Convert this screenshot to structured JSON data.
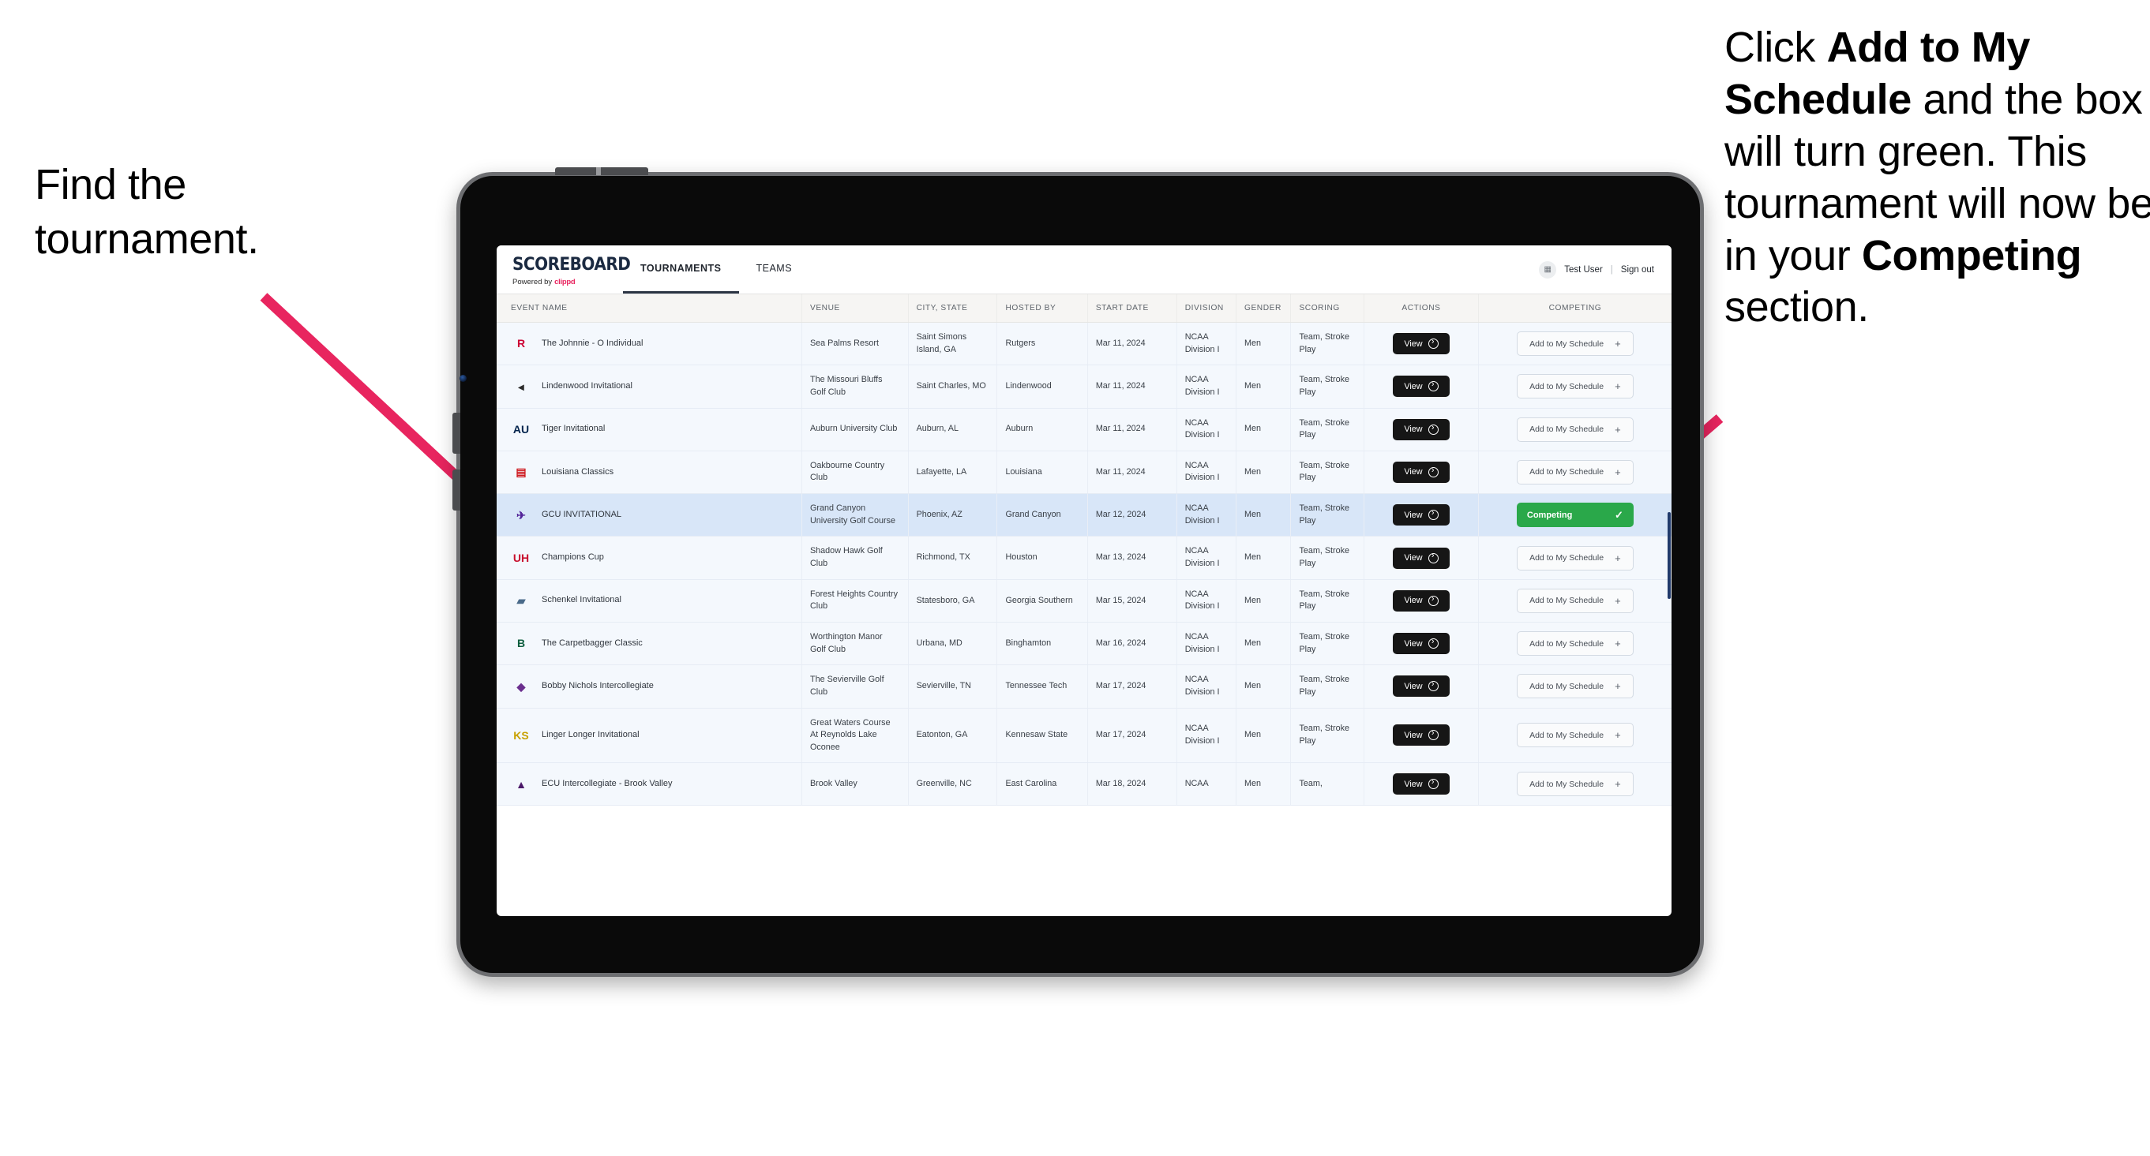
{
  "annotations": {
    "left": "Find the tournament.",
    "right_parts": [
      {
        "text": "Click ",
        "bold": false
      },
      {
        "text": "Add to My Schedule",
        "bold": true
      },
      {
        "text": " and the box will turn green. This tournament will now be in your ",
        "bold": false
      },
      {
        "text": "Competing",
        "bold": true
      },
      {
        "text": " section.",
        "bold": false
      }
    ],
    "arrow_color": "#e8255f"
  },
  "app": {
    "brand": {
      "title": "SCOREBOARD",
      "powered_prefix": "Powered by",
      "powered_brand": "clippd"
    },
    "nav": [
      {
        "label": "TOURNAMENTS",
        "active": true
      },
      {
        "label": "TEAMS",
        "active": false
      }
    ],
    "header_right": {
      "avatar_icon": "grid-icon",
      "user": "Test User",
      "separator": "|",
      "signout": "Sign out"
    }
  },
  "table": {
    "columns": [
      "EVENT NAME",
      "VENUE",
      "CITY, STATE",
      "HOSTED BY",
      "START DATE",
      "DIVISION",
      "GENDER",
      "SCORING",
      "ACTIONS",
      "COMPETING"
    ],
    "labels": {
      "view": "View",
      "add": "Add to My Schedule",
      "competing": "Competing",
      "plus": "+",
      "check": "✓"
    },
    "rows": [
      {
        "logo": "rutgers-logo",
        "logo_text": "R",
        "logo_color": "#cc0033",
        "event": "The Johnnie - O Individual",
        "venue": "Sea Palms Resort",
        "city": "Saint Simons Island, GA",
        "host": "Rutgers",
        "date": "Mar 11, 2024",
        "division": "NCAA Division I",
        "gender": "Men",
        "scoring": "Team, Stroke Play",
        "competing": false,
        "highlight": false
      },
      {
        "logo": "lindenwood-logo",
        "logo_text": "◂",
        "logo_color": "#2b2b2b",
        "event": "Lindenwood Invitational",
        "venue": "The Missouri Bluffs Golf Club",
        "city": "Saint Charles, MO",
        "host": "Lindenwood",
        "date": "Mar 11, 2024",
        "division": "NCAA Division I",
        "gender": "Men",
        "scoring": "Team, Stroke Play",
        "competing": false,
        "highlight": false
      },
      {
        "logo": "auburn-logo",
        "logo_text": "AU",
        "logo_color": "#03244d",
        "event": "Tiger Invitational",
        "venue": "Auburn University Club",
        "city": "Auburn, AL",
        "host": "Auburn",
        "date": "Mar 11, 2024",
        "division": "NCAA Division I",
        "gender": "Men",
        "scoring": "Team, Stroke Play",
        "competing": false,
        "highlight": false
      },
      {
        "logo": "louisiana-logo",
        "logo_text": "▤",
        "logo_color": "#ce181e",
        "event": "Louisiana Classics",
        "venue": "Oakbourne Country Club",
        "city": "Lafayette, LA",
        "host": "Louisiana",
        "date": "Mar 11, 2024",
        "division": "NCAA Division I",
        "gender": "Men",
        "scoring": "Team, Stroke Play",
        "competing": false,
        "highlight": false
      },
      {
        "logo": "gcu-logo",
        "logo_text": "✈",
        "logo_color": "#522398",
        "event": "GCU INVITATIONAL",
        "venue": "Grand Canyon University Golf Course",
        "city": "Phoenix, AZ",
        "host": "Grand Canyon",
        "date": "Mar 12, 2024",
        "division": "NCAA Division I",
        "gender": "Men",
        "scoring": "Team, Stroke Play",
        "competing": true,
        "highlight": true
      },
      {
        "logo": "houston-logo",
        "logo_text": "UH",
        "logo_color": "#c8102e",
        "event": "Champions Cup",
        "venue": "Shadow Hawk Golf Club",
        "city": "Richmond, TX",
        "host": "Houston",
        "date": "Mar 13, 2024",
        "division": "NCAA Division I",
        "gender": "Men",
        "scoring": "Team, Stroke Play",
        "competing": false,
        "highlight": false
      },
      {
        "logo": "georgia-southern-logo",
        "logo_text": "▰",
        "logo_color": "#4a6a8a",
        "event": "Schenkel Invitational",
        "venue": "Forest Heights Country Club",
        "city": "Statesboro, GA",
        "host": "Georgia Southern",
        "date": "Mar 15, 2024",
        "division": "NCAA Division I",
        "gender": "Men",
        "scoring": "Team, Stroke Play",
        "competing": false,
        "highlight": false
      },
      {
        "logo": "binghamton-logo",
        "logo_text": "B",
        "logo_color": "#0d5e3f",
        "event": "The Carpetbagger Classic",
        "venue": "Worthington Manor Golf Club",
        "city": "Urbana, MD",
        "host": "Binghamton",
        "date": "Mar 16, 2024",
        "division": "NCAA Division I",
        "gender": "Men",
        "scoring": "Team, Stroke Play",
        "competing": false,
        "highlight": false
      },
      {
        "logo": "tennessee-tech-logo",
        "logo_text": "◆",
        "logo_color": "#6b2f8e",
        "event": "Bobby Nichols Intercollegiate",
        "venue": "The Sevierville Golf Club",
        "city": "Sevierville, TN",
        "host": "Tennessee Tech",
        "date": "Mar 17, 2024",
        "division": "NCAA Division I",
        "gender": "Men",
        "scoring": "Team, Stroke Play",
        "competing": false,
        "highlight": false
      },
      {
        "logo": "kennesaw-state-logo",
        "logo_text": "KS",
        "logo_color": "#c8a100",
        "event": "Linger Longer Invitational",
        "venue": "Great Waters Course At Reynolds Lake Oconee",
        "city": "Eatonton, GA",
        "host": "Kennesaw State",
        "date": "Mar 17, 2024",
        "division": "NCAA Division I",
        "gender": "Men",
        "scoring": "Team, Stroke Play",
        "competing": false,
        "highlight": false
      },
      {
        "logo": "east-carolina-logo",
        "logo_text": "▲",
        "logo_color": "#4b1869",
        "event": "ECU Intercollegiate - Brook Valley",
        "venue": "Brook Valley",
        "city": "Greenville, NC",
        "host": "East Carolina",
        "date": "Mar 18, 2024",
        "division": "NCAA",
        "gender": "Men",
        "scoring": "Team,",
        "competing": false,
        "highlight": false,
        "partial": true
      }
    ]
  }
}
